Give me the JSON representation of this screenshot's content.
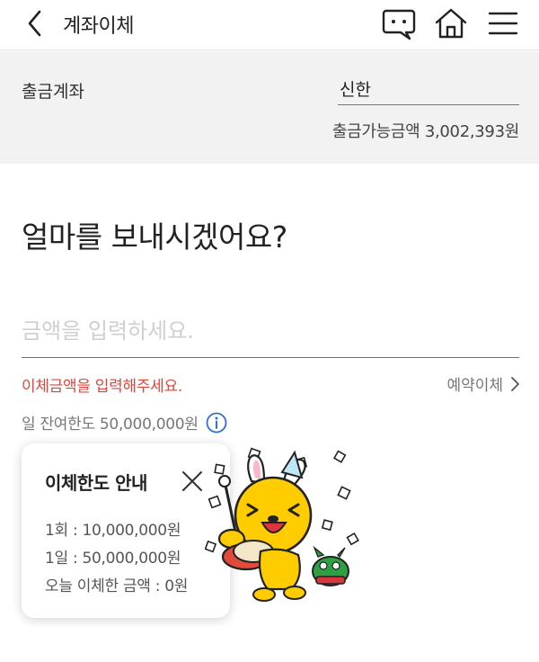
{
  "header": {
    "title": "계좌이체",
    "icons": [
      "back-chevron-icon",
      "chat-icon",
      "home-icon",
      "menu-icon"
    ]
  },
  "account": {
    "label": "출금계좌",
    "bank": "신한",
    "available_text": "출금가능금액 3,002,393원"
  },
  "question": "얼마를 보내시겠어요?",
  "amount_input": {
    "value": "",
    "placeholder": "금액을 입력하세요."
  },
  "error_text": "이체금액을 입력해주세요.",
  "reserve_label": "예약이체",
  "daily_limit_text": "일 잔여한도 50,000,000원",
  "tooltip": {
    "title": "이체한도 안내",
    "per_transfer": "1회 : 10,000,000원",
    "per_day": "1일 : 50,000,000원",
    "today": "오늘 이체한 금액 : 0원"
  },
  "colors": {
    "accent_red": "#e0453a",
    "account_bg": "#f2f2f2",
    "mascot_yellow": "#ffcc00"
  }
}
